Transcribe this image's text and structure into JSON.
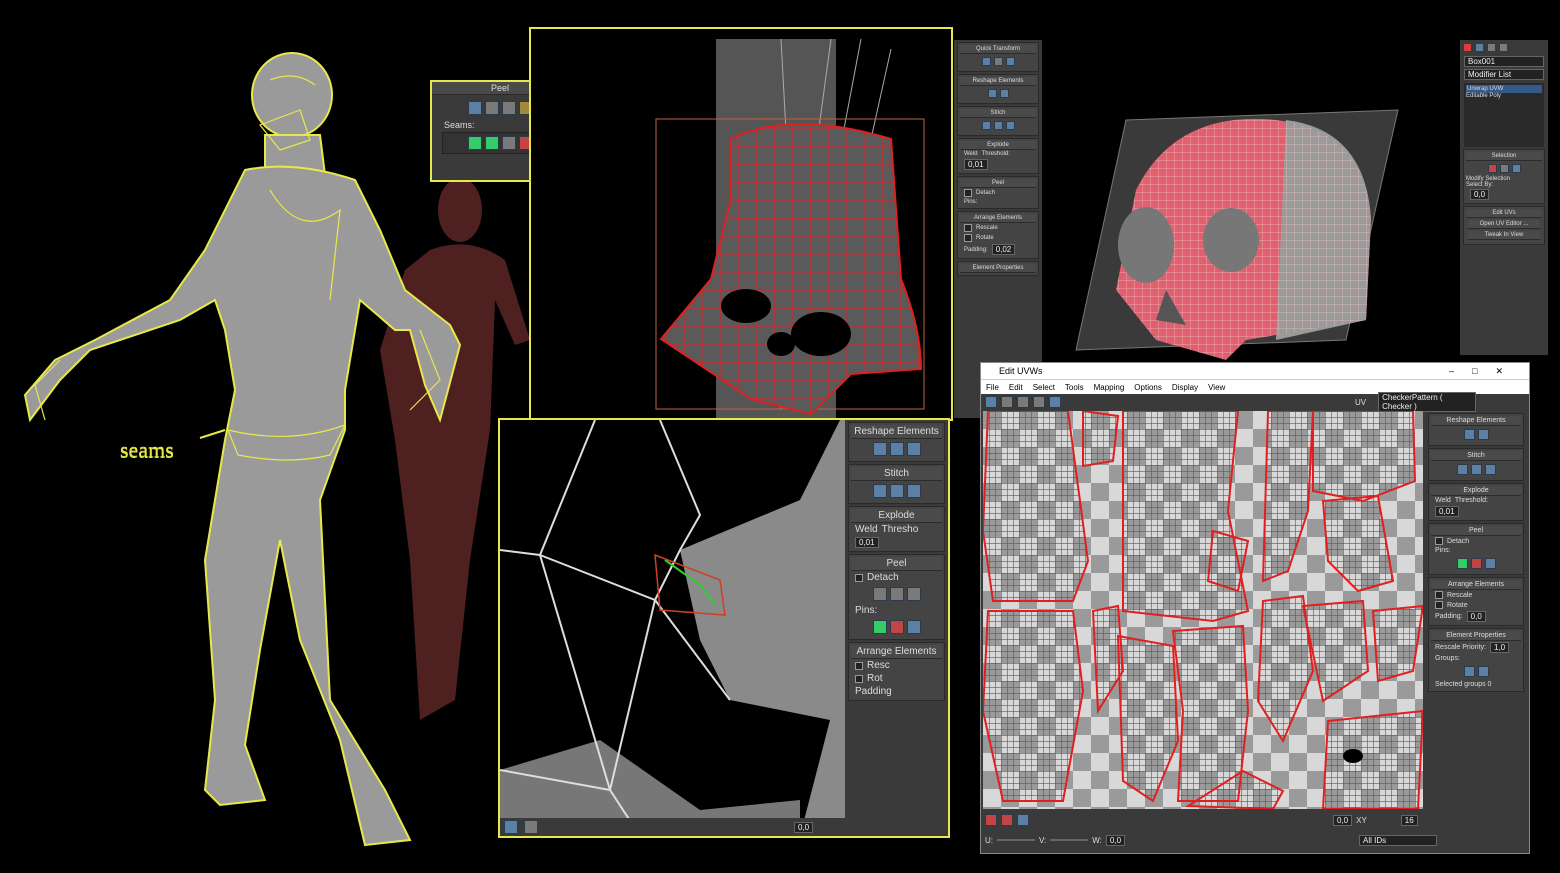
{
  "annotations": {
    "seams_label": "seams"
  },
  "peel_popup": {
    "title": "Peel",
    "seams_label": "Seams:"
  },
  "topbar": {
    "quick_transform": "Quick Transform",
    "reshape": "Reshape Elements",
    "stitch": "Stitch",
    "explode": "Explode",
    "weld": "Weld",
    "threshold": "Threshold:",
    "threshold_val": "0,01",
    "peel": "Peel",
    "detach": "Detach",
    "pins": "Pins:",
    "arrange": "Arrange Elements",
    "rescale": "Rescale",
    "rotate": "Rotate",
    "padding": "Padding:",
    "padding_val": "0,02",
    "element_props": "Element Properties"
  },
  "cmd_panel": {
    "object_name": "Box001",
    "modifier_list": "Modifier List",
    "stack": [
      "Unwrap UVW",
      "Editable Poly"
    ],
    "selection": "Selection",
    "modify_selection": "Modify Selection",
    "select_by": "Select By:",
    "select_val": "0,0",
    "edit_uvs": "Edit UVs",
    "open_uv_editor": "Open UV Editor ...",
    "tweak_in_view": "Tweak In View"
  },
  "zoom_panel": {
    "reshape": "Reshape Elements",
    "stitch": "Stitch",
    "explode": "Explode",
    "weld": "Weld",
    "threshold": "Thresho",
    "threshold_val": "0,01",
    "peel": "Peel",
    "detach": "Detach",
    "pins": "Pins:",
    "arrange": "Arrange Elements",
    "rescale": "Resc",
    "rotate": "Rot",
    "padding": "Padding",
    "zoom_val": "0,0"
  },
  "edit_uvw": {
    "title": "Edit UVWs",
    "menus": [
      "File",
      "Edit",
      "Select",
      "Tools",
      "Mapping",
      "Options",
      "Display",
      "View"
    ],
    "uv_label": "UV",
    "checker": "CheckerPattern  ( Checker )",
    "panel": {
      "reshape": "Reshape Elements",
      "stitch": "Stitch",
      "explode": "Explode",
      "weld": "Weld",
      "threshold": "Threshold:",
      "threshold_val": "0,01",
      "peel": "Peel",
      "detach": "Detach",
      "pins": "Pins:",
      "arrange": "Arrange Elements",
      "rescale": "Rescale",
      "rotate": "Rotate",
      "padding": "Padding:",
      "padding_val": "0,0",
      "element_props": "Element Properties",
      "rescale_priority": "Rescale Priority:",
      "rescale_priority_val": "1,0",
      "groups": "Groups:",
      "selected_groups": "Selected groups 0"
    },
    "bottom": {
      "val1": "0,0",
      "xy": "XY",
      "val2": "16",
      "u_label": "U:",
      "v_label": "V:",
      "w_label": "W:",
      "w_val": "0,0",
      "all_ids": "All IDs"
    }
  },
  "colors": {
    "highlight": "#e8e84a",
    "uv_red": "#e02020",
    "panel": "#3a3a3a"
  }
}
